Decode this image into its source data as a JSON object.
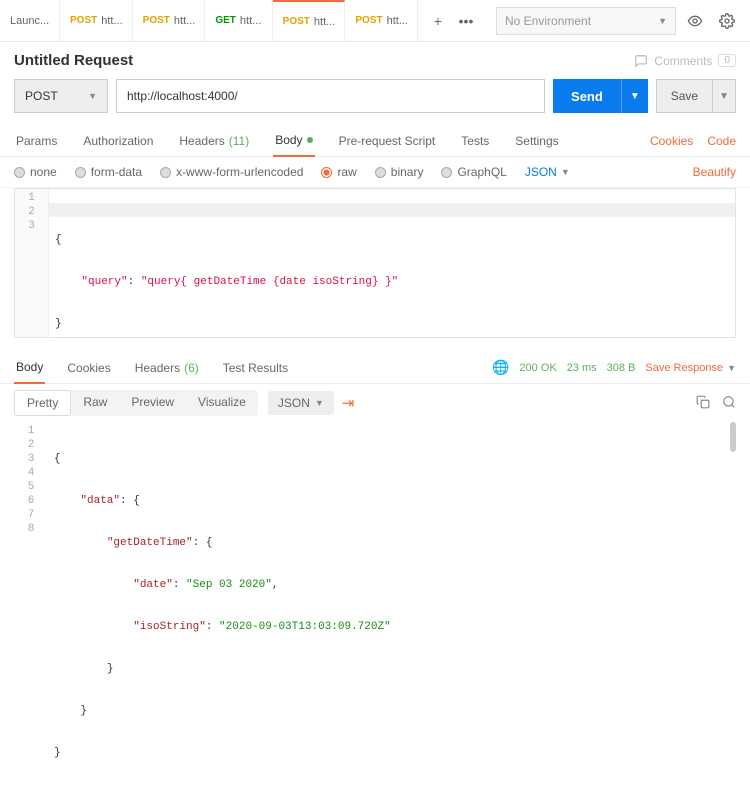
{
  "tabs": [
    {
      "method": "",
      "label": "Launc..."
    },
    {
      "method": "POST",
      "label": "htt..."
    },
    {
      "method": "POST",
      "label": "htt..."
    },
    {
      "method": "GET",
      "label": "htt..."
    },
    {
      "method": "POST",
      "label": "htt..."
    },
    {
      "method": "POST",
      "label": "htt..."
    }
  ],
  "environment": {
    "selected": "No Environment"
  },
  "request": {
    "title": "Untitled Request",
    "comments": {
      "label": "Comments",
      "count": "0"
    },
    "method": "POST",
    "url": "http://localhost:4000/",
    "send": "Send",
    "save": "Save"
  },
  "req_tabs": {
    "params": "Params",
    "authorization": "Authorization",
    "headers": "Headers",
    "headers_count": "(11)",
    "body": "Body",
    "prerequest": "Pre-request Script",
    "tests": "Tests",
    "settings": "Settings",
    "cookies": "Cookies",
    "code": "Code"
  },
  "body_types": {
    "none": "none",
    "form_data": "form-data",
    "urlencoded": "x-www-form-urlencoded",
    "raw": "raw",
    "binary": "binary",
    "graphql": "GraphQL",
    "content_type": "JSON",
    "beautify": "Beautify"
  },
  "request_body_lines": [
    "{",
    "    \"query\": \"query{ getDateTime {date isoString} }\"",
    "}"
  ],
  "response_tabs": {
    "body": "Body",
    "cookies": "Cookies",
    "headers": "Headers",
    "headers_count": "(6)",
    "test_results": "Test Results"
  },
  "response_meta": {
    "status": "200 OK",
    "time": "23 ms",
    "size": "308 B",
    "save": "Save Response"
  },
  "view_modes": {
    "pretty": "Pretty",
    "raw": "Raw",
    "preview": "Preview",
    "visualize": "Visualize",
    "content_type": "JSON"
  },
  "response_body": {
    "lines": [
      "1",
      "2",
      "3",
      "4",
      "5",
      "6",
      "7",
      "8"
    ],
    "data_key": "\"data\"",
    "getDateTime_key": "\"getDateTime\"",
    "date_key": "\"date\"",
    "date_val": "\"Sep 03 2020\"",
    "iso_key": "\"isoString\"",
    "iso_val": "\"2020-09-03T13:03:09.720Z\""
  }
}
